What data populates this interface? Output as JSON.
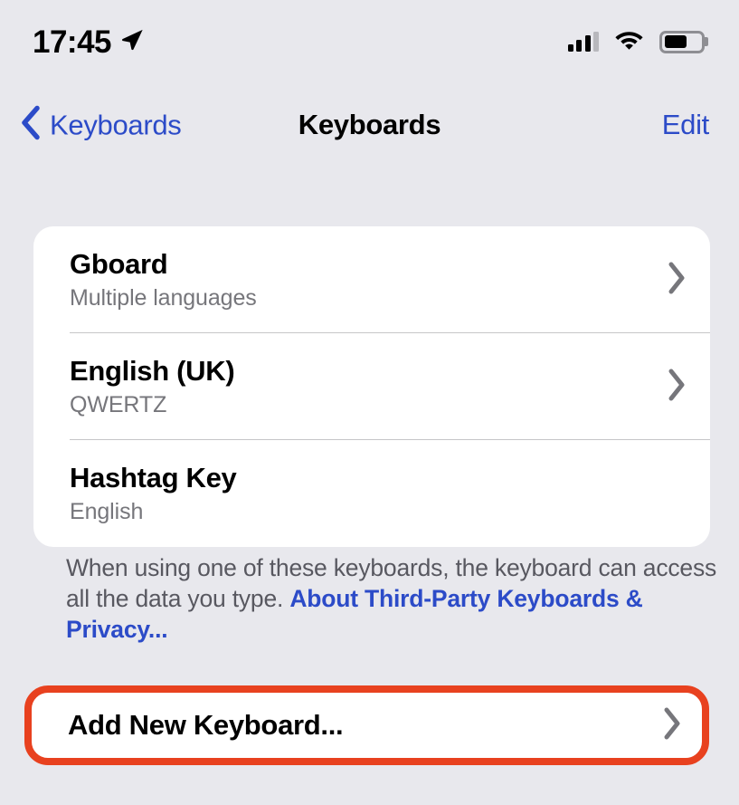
{
  "status_bar": {
    "time": "17:45",
    "location_icon": "location-arrow-icon",
    "cellular_icon": "cellular-bars-icon",
    "cellular_bars_filled": 3,
    "cellular_bars_total": 4,
    "wifi_icon": "wifi-icon",
    "battery_icon": "battery-icon",
    "battery_level_percent": 62
  },
  "nav_bar": {
    "back_icon": "chevron-left-icon",
    "back_label": "Keyboards",
    "title": "Keyboards",
    "edit_label": "Edit"
  },
  "keyboards": [
    {
      "title": "Gboard",
      "subtitle": "Multiple languages",
      "has_chevron": true,
      "chevron_icon": "chevron-right-icon"
    },
    {
      "title": "English (UK)",
      "subtitle": "QWERTZ",
      "has_chevron": true,
      "chevron_icon": "chevron-right-icon"
    },
    {
      "title": "Hashtag Key",
      "subtitle": "English",
      "has_chevron": false,
      "chevron_icon": ""
    }
  ],
  "footer": {
    "text": "When using one of these keyboards, the keyboard can access all the data you type. ",
    "link_text": "About Third-Party Keyboards & Privacy..."
  },
  "add_keyboard": {
    "label": "Add New Keyboard...",
    "chevron_icon": "chevron-right-icon",
    "highlighted": true,
    "highlight_color": "#e8411f"
  },
  "colors": {
    "background": "#e8e8ed",
    "card": "#ffffff",
    "accent_blue": "#2c4bc8",
    "secondary_text": "#76767b",
    "separator": "#c6c6c8",
    "highlight_red": "#e8411f"
  }
}
